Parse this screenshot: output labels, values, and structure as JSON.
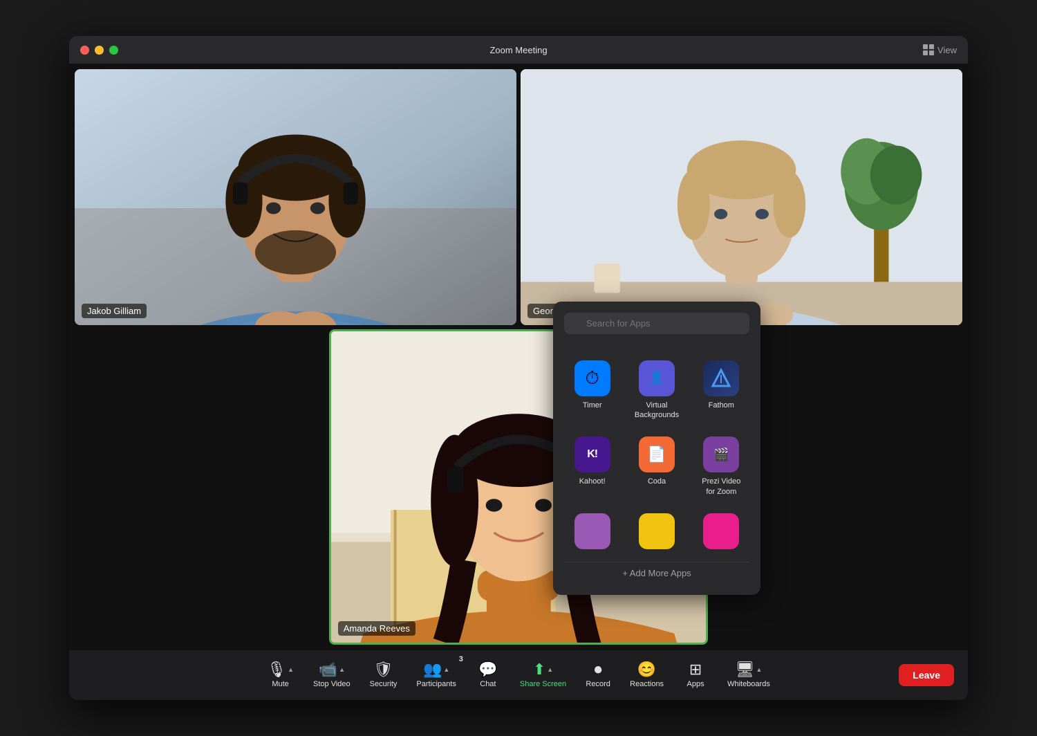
{
  "window": {
    "title": "Zoom Meeting",
    "view_label": "View"
  },
  "traffic_lights": {
    "close": "close",
    "minimize": "minimize",
    "maximize": "maximize"
  },
  "participants": [
    {
      "name": "Jakob Gilliam",
      "id": "jakob"
    },
    {
      "name": "George Meza",
      "id": "george"
    },
    {
      "name": "Amanda Reeves",
      "id": "amanda"
    }
  ],
  "toolbar": {
    "mute_label": "Mute",
    "stop_video_label": "Stop Video",
    "security_label": "Security",
    "participants_label": "Participants",
    "participants_count": "3",
    "chat_label": "Chat",
    "share_screen_label": "Share Screen",
    "record_label": "Record",
    "reactions_label": "Reactions",
    "apps_label": "Apps",
    "whiteboards_label": "Whiteboards",
    "leave_label": "Leave"
  },
  "apps_popup": {
    "search_placeholder": "Search for Apps",
    "apps": [
      {
        "name": "Timer",
        "icon_type": "timer"
      },
      {
        "name": "Virtual Backgrounds",
        "icon_type": "vbg"
      },
      {
        "name": "Fathom",
        "icon_type": "fathom"
      },
      {
        "name": "Kahoot!",
        "icon_type": "kahoot"
      },
      {
        "name": "Coda",
        "icon_type": "coda"
      },
      {
        "name": "Prezi Video for Zoom",
        "icon_type": "prezi"
      }
    ],
    "add_more_label": "+ Add More Apps"
  }
}
